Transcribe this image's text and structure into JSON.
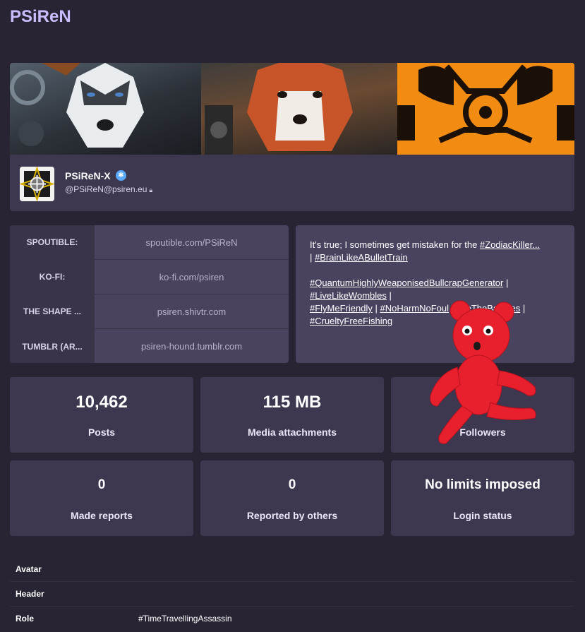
{
  "page": {
    "title": "PSiReN"
  },
  "profile": {
    "display_name": "PSiReN-X",
    "account": "@PSiReN@psiren.eu",
    "verified_icon": "paw-badge-icon",
    "lock_icon": "lock-icon"
  },
  "fields": [
    {
      "name": "SPOUTIBLE:",
      "value": "spoutible.com/PSiReN"
    },
    {
      "name": "KO-FI:",
      "value": "ko-fi.com/psiren"
    },
    {
      "name": "THE SHAPE ...",
      "value": "psiren.shivtr.com"
    },
    {
      "name": "TUMBLR (AR...",
      "value": "psiren-hound.tumblr.com"
    }
  ],
  "bio": {
    "line1_text": "It's true; I sometimes get mistaken for the ",
    "line1_tag": "#ZodiacKiller...",
    "line2_sep": "| ",
    "line2_tag": "#BrainLikeABulletTrain",
    "tags": {
      "t1": "#QuantumHighlyWeaponisedBullcrapGenerator",
      "t2": "#LiveLikeWombles",
      "t3": "#FlyMeFriendly",
      "t4": "#NoHarmNoFoul",
      "t4_tail": "#LifeTheBaubles",
      "t5": "#CrueltyFreeFishing"
    },
    "sep": " |"
  },
  "stats": [
    {
      "value": "10,462",
      "label": "Posts"
    },
    {
      "value": "115 MB",
      "label": "Media attachments"
    },
    {
      "value": "",
      "label": "Followers"
    },
    {
      "value": "0",
      "label": "Made reports"
    },
    {
      "value": "0",
      "label": "Reported by others"
    },
    {
      "value": "No limits imposed",
      "label": "Login status"
    }
  ],
  "admin": [
    {
      "key": "Avatar",
      "value": ""
    },
    {
      "key": "Header",
      "value": ""
    },
    {
      "key": "Role",
      "value": "#TimeTravellingAssassin"
    }
  ],
  "colors": {
    "background": "#282433",
    "card": "#3d3750",
    "accent_title": "#c9bcff",
    "bear": "#e8202e"
  }
}
